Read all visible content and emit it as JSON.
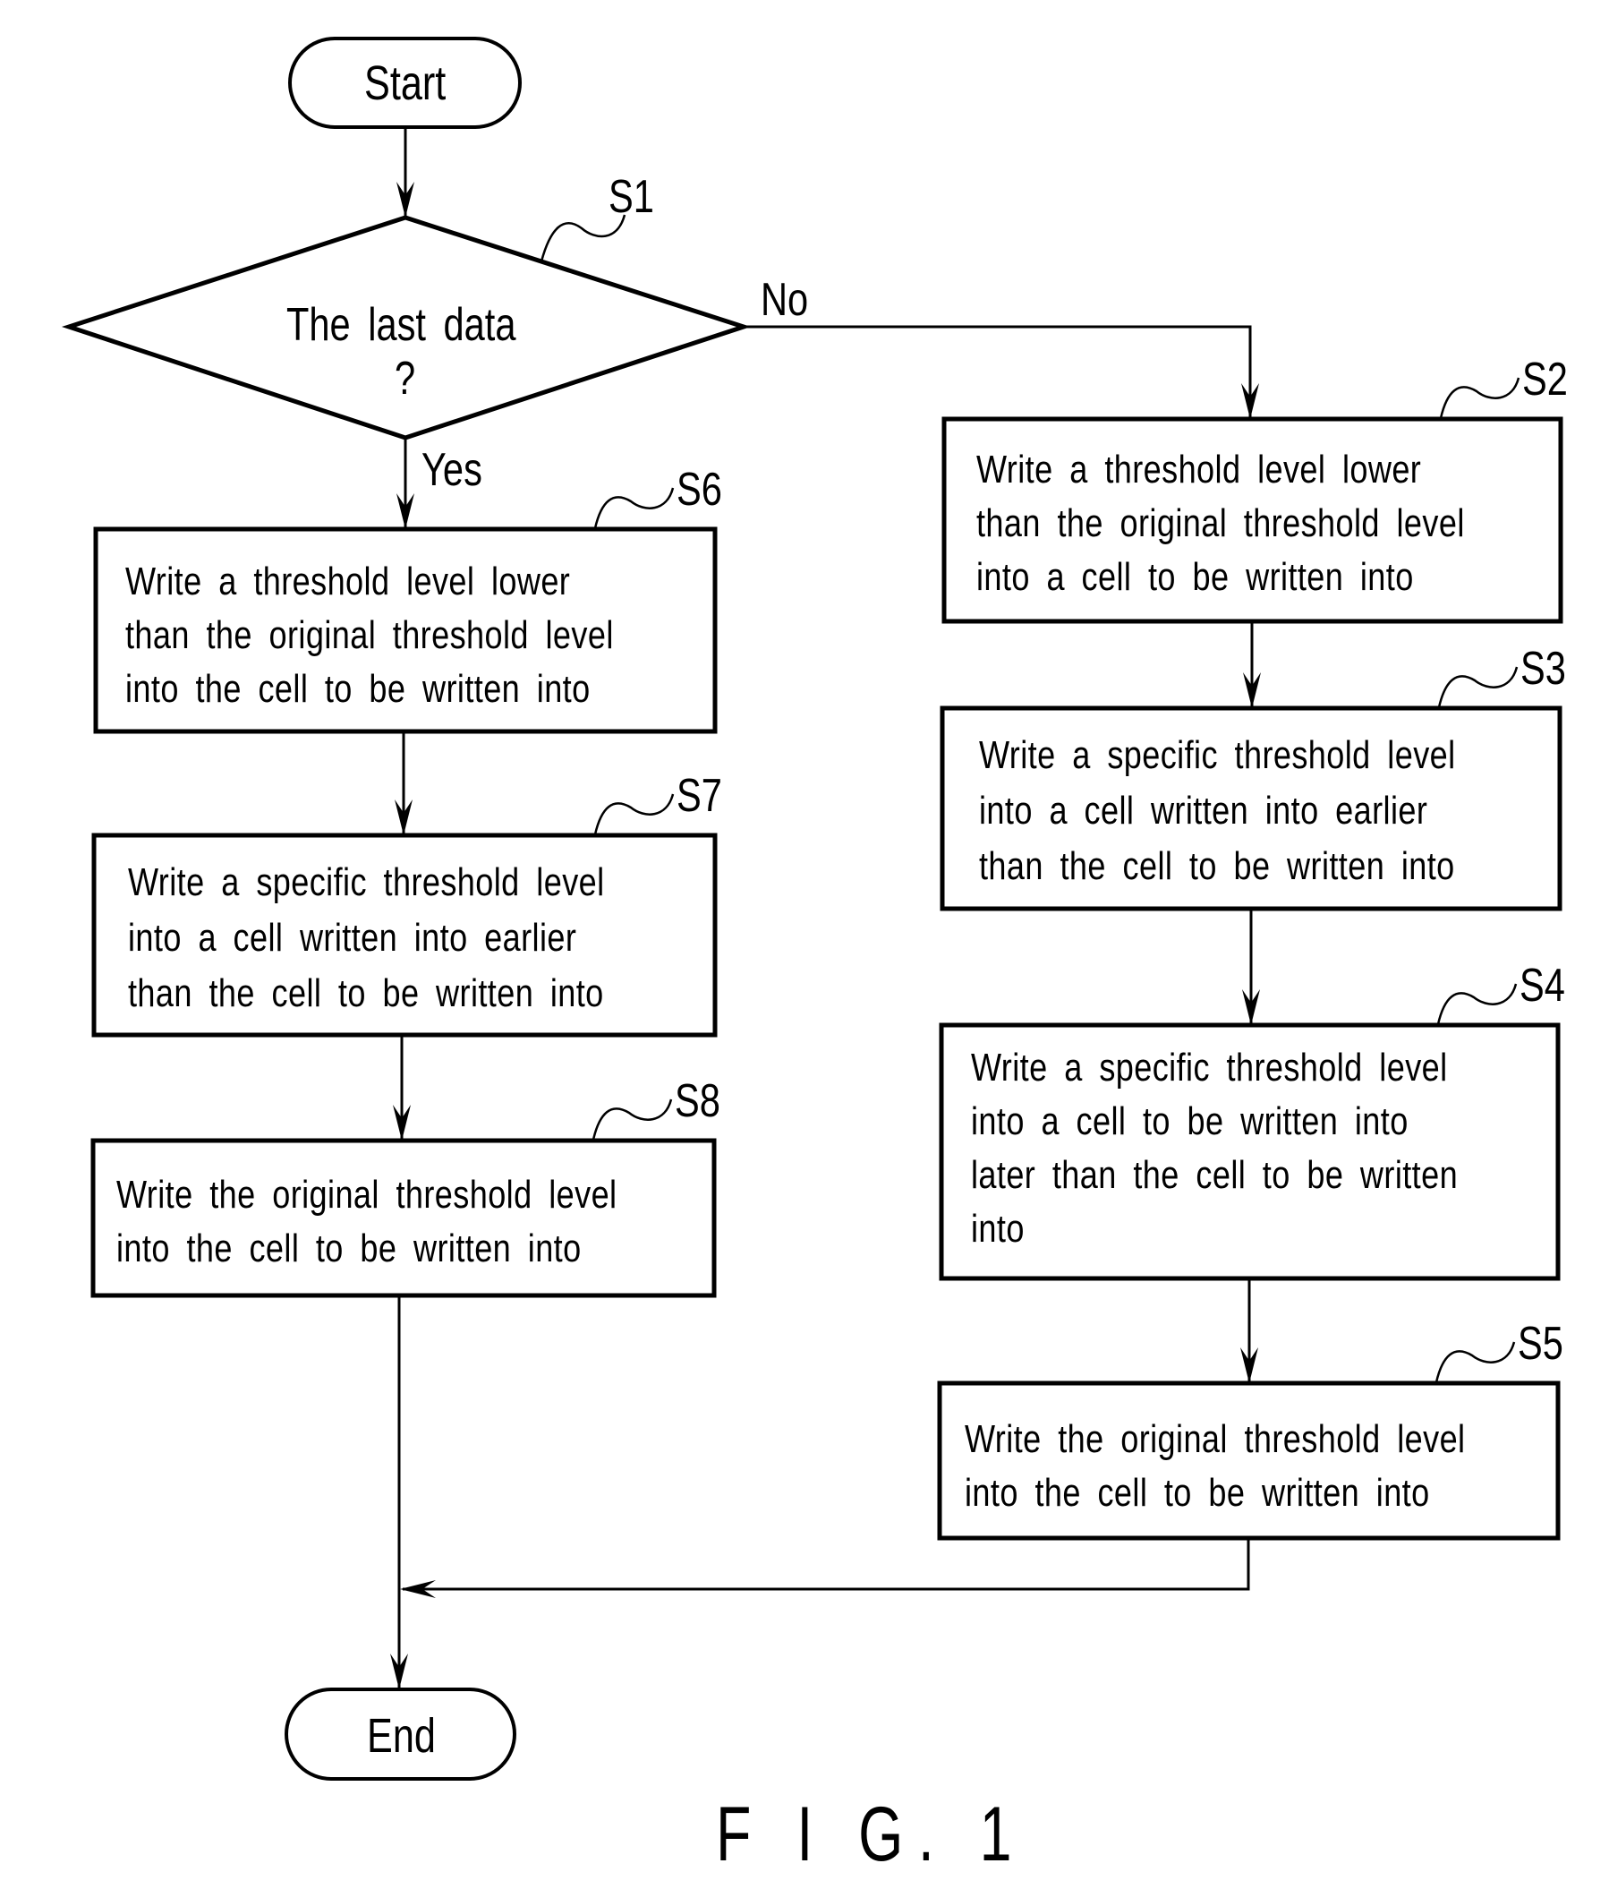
{
  "figure_label": "F I G. 1",
  "terminals": {
    "start": "Start",
    "end": "End"
  },
  "decision": {
    "id": "S1",
    "line1": "The last data",
    "line2": "?",
    "yes_label": "Yes",
    "no_label": "No"
  },
  "steps": {
    "S2": {
      "id": "S2",
      "lines": [
        "Write a threshold level lower",
        "than the original threshold level",
        "into a cell to be written into"
      ]
    },
    "S3": {
      "id": "S3",
      "lines": [
        "Write a specific threshold level",
        "into a cell written into earlier",
        "than the cell to be written into"
      ]
    },
    "S4": {
      "id": "S4",
      "lines": [
        "Write a specific threshold level",
        "into a cell to be written into",
        "later than the cell to be written",
        "into"
      ]
    },
    "S5": {
      "id": "S5",
      "lines": [
        "Write the original threshold level",
        "into the cell to be written into"
      ]
    },
    "S6": {
      "id": "S6",
      "lines": [
        "Write a threshold level lower",
        "than the original threshold level",
        "into the cell to be written into"
      ]
    },
    "S7": {
      "id": "S7",
      "lines": [
        "Write a specific threshold level",
        "into a cell written into earlier",
        "than the cell to be written into"
      ]
    },
    "S8": {
      "id": "S8",
      "lines": [
        "Write the original threshold level",
        "into the cell to be written into"
      ]
    }
  }
}
